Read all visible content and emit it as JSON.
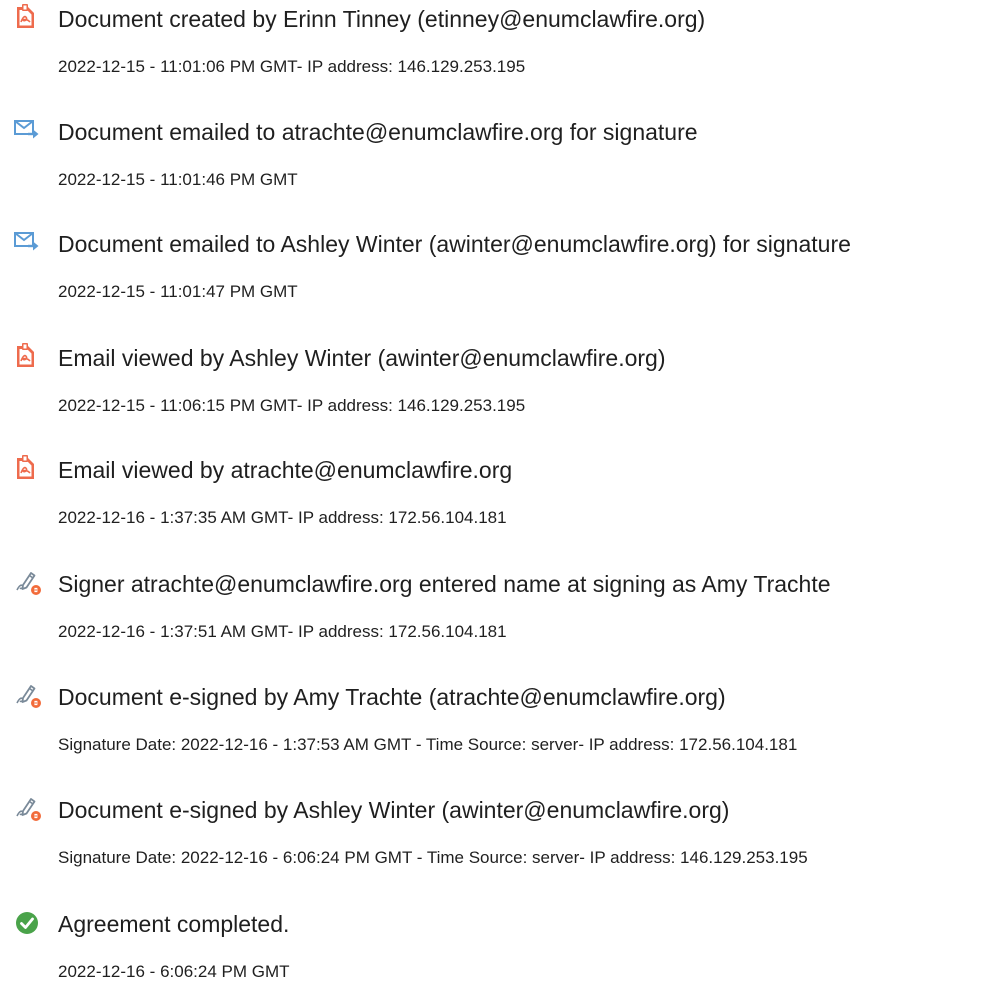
{
  "events": [
    {
      "icon": "document-created-icon",
      "title": "Document created by Erinn Tinney (etinney@enumclawfire.org)",
      "detail": "2022-12-15 - 11:01:06 PM GMT- IP address: 146.129.253.195"
    },
    {
      "icon": "email-sent-icon",
      "title": "Document emailed to atrachte@enumclawfire.org for signature",
      "detail": "2022-12-15 - 11:01:46 PM GMT"
    },
    {
      "icon": "email-sent-icon",
      "title": "Document emailed to Ashley Winter (awinter@enumclawfire.org) for signature",
      "detail": "2022-12-15 - 11:01:47 PM GMT"
    },
    {
      "icon": "document-viewed-icon",
      "title": "Email viewed by Ashley Winter (awinter@enumclawfire.org)",
      "detail": "2022-12-15 - 11:06:15 PM GMT- IP address: 146.129.253.195"
    },
    {
      "icon": "document-viewed-icon",
      "title": "Email viewed by atrachte@enumclawfire.org",
      "detail": "2022-12-16 - 1:37:35 AM GMT- IP address: 172.56.104.181"
    },
    {
      "icon": "esign-pen-icon",
      "title": "Signer atrachte@enumclawfire.org entered name at signing as Amy Trachte",
      "detail": "2022-12-16 - 1:37:51 AM GMT- IP address: 172.56.104.181"
    },
    {
      "icon": "esign-pen-icon",
      "title": "Document e-signed by Amy Trachte (atrachte@enumclawfire.org)",
      "detail": "Signature Date: 2022-12-16 - 1:37:53 AM GMT - Time Source: server- IP address: 172.56.104.181"
    },
    {
      "icon": "esign-pen-icon",
      "title": "Document e-signed by Ashley Winter (awinter@enumclawfire.org)",
      "detail": "Signature Date: 2022-12-16 - 6:06:24 PM GMT - Time Source: server- IP address: 146.129.253.195"
    },
    {
      "icon": "check-circle-icon",
      "title": "Agreement completed.",
      "detail": "2022-12-16 - 6:06:24 PM GMT"
    }
  ],
  "colors": {
    "document_icon": "#ee6b4d",
    "email_icon": "#5b9bd5",
    "pen_icon": "#7a8a99",
    "pen_badge": "#f26b3a",
    "check_icon": "#4aa34a",
    "text": "#1f1f1f"
  }
}
